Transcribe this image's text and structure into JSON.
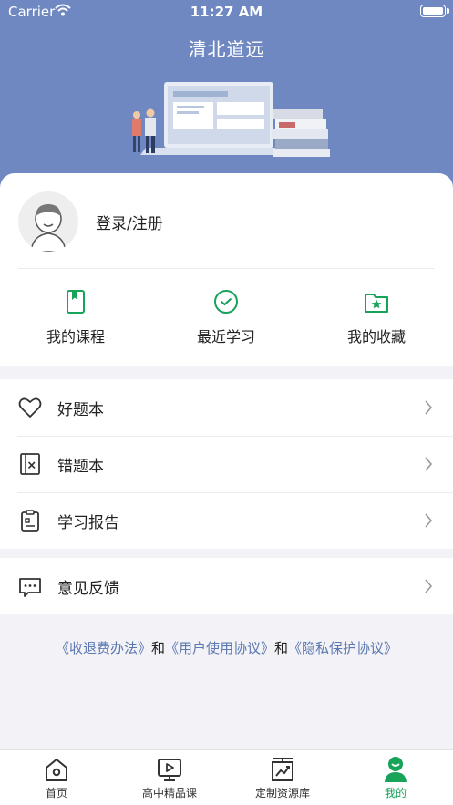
{
  "status_bar": {
    "carrier": "Carrier",
    "time": "11:27 AM"
  },
  "header": {
    "title": "清北道远"
  },
  "profile": {
    "login_label": "登录/注册"
  },
  "quick_actions": [
    {
      "label": "我的课程",
      "icon": "book-icon"
    },
    {
      "label": "最近学习",
      "icon": "clock-check-icon"
    },
    {
      "label": "我的收藏",
      "icon": "folder-star-icon"
    }
  ],
  "menu_group_1": [
    {
      "label": "好题本",
      "icon": "heart-icon"
    },
    {
      "label": "错题本",
      "icon": "wrong-book-icon"
    },
    {
      "label": "学习报告",
      "icon": "clipboard-icon"
    }
  ],
  "menu_group_2": [
    {
      "label": "意见反馈",
      "icon": "chat-bubble-icon"
    }
  ],
  "footer_links": {
    "refund": "《收退费办法》",
    "and1": "和",
    "user_agreement": "《用户使用协议》",
    "and2": "和",
    "privacy": "《隐私保护协议》"
  },
  "tab_bar": [
    {
      "label": "首页",
      "icon": "home-icon",
      "active": false
    },
    {
      "label": "高中精品课",
      "icon": "video-icon",
      "active": false
    },
    {
      "label": "定制资源库",
      "icon": "chart-board-icon",
      "active": false
    },
    {
      "label": "我的",
      "icon": "user-icon",
      "active": true
    }
  ],
  "colors": {
    "header_bg": "#6f88c2",
    "accent_green": "#17a35a",
    "link_blue": "#5b78b0"
  }
}
